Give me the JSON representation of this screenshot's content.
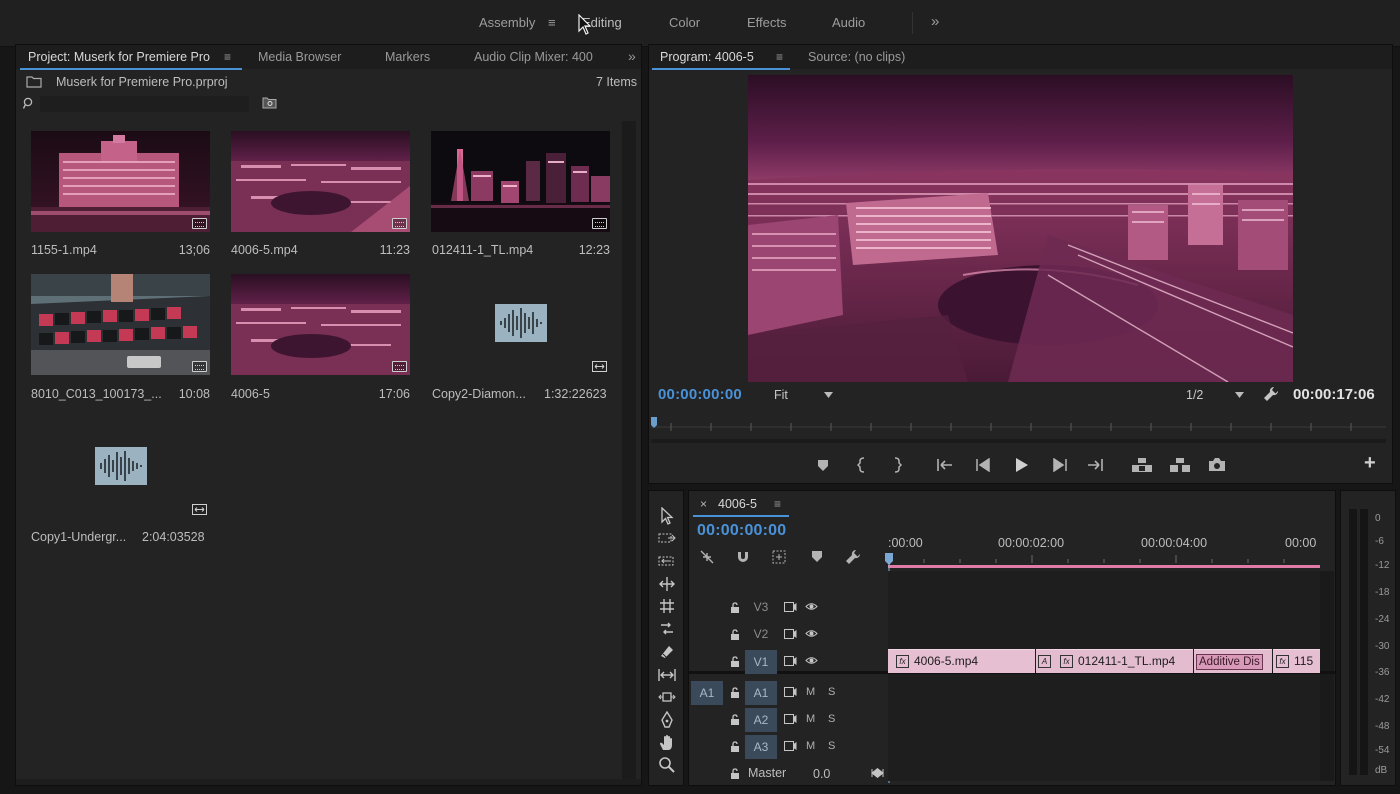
{
  "workspaces": {
    "items": [
      "Assembly",
      "Editing",
      "Color",
      "Effects",
      "Audio"
    ],
    "active": "Editing",
    "more_glyph": "»",
    "menu_glyph": "≡"
  },
  "project_panel": {
    "tabs": [
      "Project: Muserk for Premiere Pro",
      "Media Browser",
      "Markers",
      "Audio Clip Mixer: 400"
    ],
    "active_tab": "Project: Muserk for Premiere Pro",
    "more_glyph": "»",
    "project_file": "Muserk for Premiere Pro.prproj",
    "item_count": "7 Items",
    "search_placeholder": "",
    "clips": [
      {
        "name": "1155-1.mp4",
        "duration": "13;06",
        "kind": "video"
      },
      {
        "name": "4006-5.mp4",
        "duration": "11:23",
        "kind": "video"
      },
      {
        "name": "012411-1_TL.mp4",
        "duration": "12:23",
        "kind": "video"
      },
      {
        "name": "8010_C013_100173_...",
        "duration": "10:08",
        "kind": "video"
      },
      {
        "name": "4006-5",
        "duration": "17:06",
        "kind": "sequence"
      },
      {
        "name": "Copy2-Diamon...",
        "duration": "1:32:22623",
        "kind": "audio"
      },
      {
        "name": "Copy1-Undergr...",
        "duration": "2:04:03528",
        "kind": "audio"
      }
    ]
  },
  "program_monitor": {
    "tabs": [
      "Program: 4006-5",
      "Source: (no clips)"
    ],
    "active_tab": "Program: 4006-5",
    "timecode_current": "00:00:00:00",
    "zoom": "Fit",
    "resolution": "1/2",
    "timecode_duration": "00:00:17:06",
    "add_glyph": "+"
  },
  "timeline": {
    "sequence_name": "4006-5",
    "close_glyph": "×",
    "timecode": "00:00:00:00",
    "ruler_labels": [
      ":00:00",
      "00:00:02:00",
      "00:00:04:00",
      "00:00"
    ],
    "video_tracks": [
      "V3",
      "V2",
      "V1"
    ],
    "audio_tracks": [
      "A1",
      "A2",
      "A3"
    ],
    "source_patch": "A1",
    "mute_label": "M",
    "solo_label": "S",
    "master_label": "Master",
    "master_value": "0.0",
    "clips_v1": [
      {
        "name": "4006-5.mp4"
      },
      {
        "name": "012411-1_TL.mp4"
      },
      {
        "name": "115"
      }
    ],
    "transition_label": "Additive Dis",
    "transition_marker": "A",
    "fx_label": "fx"
  },
  "audio_meter": {
    "scale": [
      "0",
      "-6",
      "-12",
      "-18",
      "-24",
      "-30",
      "-36",
      "-42",
      "-48",
      "-54",
      "dB"
    ]
  },
  "colors": {
    "accent_blue": "#4a92d8",
    "clip_pink": "#e6bfd2",
    "playhead_pink": "#e07ba8",
    "background": "#232323"
  }
}
